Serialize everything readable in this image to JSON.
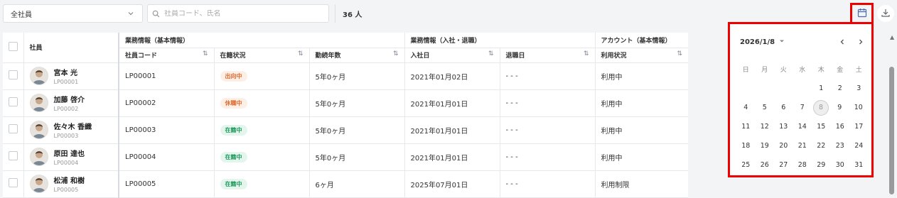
{
  "toolbar": {
    "company_select": "全社員",
    "search_placeholder": "社員コード、氏名",
    "count_text": "36 人"
  },
  "table": {
    "groups": {
      "basic": "業務情報（基本情報）",
      "join_leave": "業務情報（入社・退職）",
      "account": "アカウント（基本情報）"
    },
    "headers": {
      "employee": "社員",
      "code": "社員コード",
      "status": "在籍状況",
      "years": "勤続年数",
      "join_date": "入社日",
      "leave_date": "退職日",
      "usage": "利用状況"
    },
    "rows": [
      {
        "name": "宮本 光",
        "id": "LP00001",
        "code": "LP00001",
        "status": "出向中",
        "status_color": "#e06a2c",
        "years": "5年0ヶ月",
        "join": "2021年01月02日",
        "leave": "- - -",
        "usage": "利用中"
      },
      {
        "name": "加藤 啓介",
        "id": "LP00002",
        "code": "LP00002",
        "status": "休職中",
        "status_color": "#e06a2c",
        "years": "5年0ヶ月",
        "join": "2021年01月01日",
        "leave": "- - -",
        "usage": "利用中"
      },
      {
        "name": "佐々木 香織",
        "id": "LP00003",
        "code": "LP00003",
        "status": "在籍中",
        "status_color": "#1f9a5c",
        "years": "5年0ヶ月",
        "join": "2021年01月01日",
        "leave": "- - -",
        "usage": "利用中"
      },
      {
        "name": "原田 達也",
        "id": "LP00004",
        "code": "LP00004",
        "status": "在籍中",
        "status_color": "#1f9a5c",
        "years": "5年0ヶ月",
        "join": "2021年01月01日",
        "leave": "- - -",
        "usage": "利用中"
      },
      {
        "name": "松浦 和樹",
        "id": "LP00005",
        "code": "LP00005",
        "status": "在籍中",
        "status_color": "#1f9a5c",
        "years": "6ヶ月",
        "join": "2025年07月01日",
        "leave": "- - -",
        "usage": "利用制限"
      }
    ]
  },
  "calendar": {
    "current": "2026/1/8",
    "weekdays": [
      "日",
      "月",
      "火",
      "水",
      "木",
      "金",
      "土"
    ],
    "weeks": [
      [
        "",
        "",
        "",
        "",
        "1",
        "2",
        "3"
      ],
      [
        "4",
        "5",
        "6",
        "7",
        "8",
        "9",
        "10"
      ],
      [
        "11",
        "12",
        "13",
        "14",
        "15",
        "16",
        "17"
      ],
      [
        "18",
        "19",
        "20",
        "21",
        "22",
        "23",
        "24"
      ],
      [
        "25",
        "26",
        "27",
        "28",
        "29",
        "30",
        "31"
      ]
    ],
    "selected_day": "8"
  }
}
